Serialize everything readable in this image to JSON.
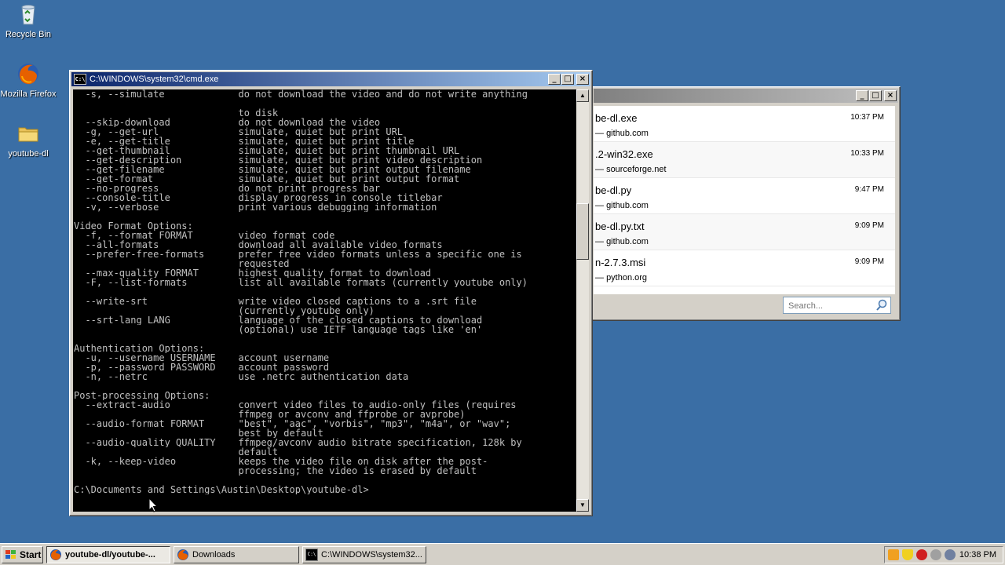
{
  "desktop": {
    "icons": [
      {
        "label": "Recycle Bin",
        "icon": "recycle-bin-icon"
      },
      {
        "label": "Mozilla Firefox",
        "icon": "firefox-icon"
      },
      {
        "label": "youtube-dl",
        "icon": "folder-icon"
      }
    ]
  },
  "cmd": {
    "title": "C:\\WINDOWS\\system32\\cmd.exe",
    "icon_text": "C:\\",
    "lines": [
      "  -s, --simulate             do not download the video and do not write anything",
      "",
      "                             to disk",
      "  --skip-download            do not download the video",
      "  -g, --get-url              simulate, quiet but print URL",
      "  -e, --get-title            simulate, quiet but print title",
      "  --get-thumbnail            simulate, quiet but print thumbnail URL",
      "  --get-description          simulate, quiet but print video description",
      "  --get-filename             simulate, quiet but print output filename",
      "  --get-format               simulate, quiet but print output format",
      "  --no-progress              do not print progress bar",
      "  --console-title            display progress in console titlebar",
      "  -v, --verbose              print various debugging information",
      "",
      "Video Format Options:",
      "  -f, --format FORMAT        video format code",
      "  --all-formats              download all available video formats",
      "  --prefer-free-formats      prefer free video formats unless a specific one is",
      "                             requested",
      "  --max-quality FORMAT       highest quality format to download",
      "  -F, --list-formats         list all available formats (currently youtube only)",
      "",
      "  --write-srt                write video closed captions to a .srt file",
      "                             (currently youtube only)",
      "  --srt-lang LANG            language of the closed captions to download",
      "                             (optional) use IETF language tags like 'en'",
      "",
      "Authentication Options:",
      "  -u, --username USERNAME    account username",
      "  -p, --password PASSWORD    account password",
      "  -n, --netrc                use .netrc authentication data",
      "",
      "Post-processing Options:",
      "  --extract-audio            convert video files to audio-only files (requires",
      "                             ffmpeg or avconv and ffprobe or avprobe)",
      "  --audio-format FORMAT      \"best\", \"aac\", \"vorbis\", \"mp3\", \"m4a\", or \"wav\";",
      "                             best by default",
      "  --audio-quality QUALITY    ffmpeg/avconv audio bitrate specification, 128k by",
      "                             default",
      "  -k, --keep-video           keeps the video file on disk after the post-",
      "                             processing; the video is erased by default",
      "",
      "C:\\Documents and Settings\\Austin\\Desktop\\youtube-dl>"
    ]
  },
  "downloads": {
    "title": "Downloads",
    "items": [
      {
        "name": "be-dl.exe",
        "source": "github.com",
        "time": "10:37 PM"
      },
      {
        "name": ".2-win32.exe",
        "source": "sourceforge.net",
        "time": "10:33 PM"
      },
      {
        "name": "be-dl.py",
        "source": "github.com",
        "time": "9:47 PM"
      },
      {
        "name": "be-dl.py.txt",
        "source": "github.com",
        "time": "9:09 PM"
      },
      {
        "name": "n-2.7.3.msi",
        "source": "python.org",
        "time": "9:09 PM"
      }
    ],
    "search_placeholder": "Search..."
  },
  "taskbar": {
    "start_label": "Start",
    "tasks": [
      {
        "label": "youtube-dl/youtube-...",
        "icon": "firefox-icon",
        "active": true
      },
      {
        "label": "Downloads",
        "icon": "firefox-icon",
        "active": false
      },
      {
        "label": "C:\\WINDOWS\\system32...",
        "icon": "cmd-icon",
        "active": false
      }
    ],
    "clock": "10:38 PM"
  },
  "colors": {
    "desktop": "#3a6ea5",
    "active_title": "#0a246a",
    "console_bg": "#000000",
    "console_fg": "#c0c0c0"
  }
}
